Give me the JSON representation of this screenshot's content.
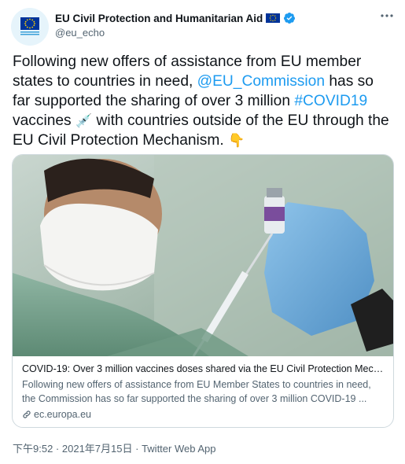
{
  "account": {
    "display_name": "EU Civil Protection and Humanitarian Aid",
    "handle": "@eu_echo",
    "avatar_text": "Humanitarian Aid and Civil Protection"
  },
  "tweet": {
    "text_1": "Following new offers of assistance from EU member states to countries in need, ",
    "mention": "@EU_Commission",
    "text_2": " has so far supported the sharing of over 3 million ",
    "hashtag": "#COVID19",
    "text_3": " vaccines ",
    "emoji_syringe": "💉",
    "text_4": " with countries outside of the EU through the EU Civil Protection Mechanism. ",
    "emoji_point": "👇"
  },
  "card": {
    "title": "COVID-19: Over 3 million vaccines doses shared via the EU Civil Protection Mech...",
    "description": "Following new offers of assistance from EU Member States to countries in need, the Commission has so far supported the sharing of over 3 million COVID-19 ...",
    "domain": "ec.europa.eu"
  },
  "meta": {
    "time": "下午9:52",
    "separator": " · ",
    "date": "2021年7月15日",
    "separator2": " · ",
    "app": "Twitter Web App"
  },
  "colors": {
    "link": "#1d9bf0",
    "verified": "#1d9bf0",
    "eu_flag": "#003399",
    "secondary_text": "#536471"
  }
}
